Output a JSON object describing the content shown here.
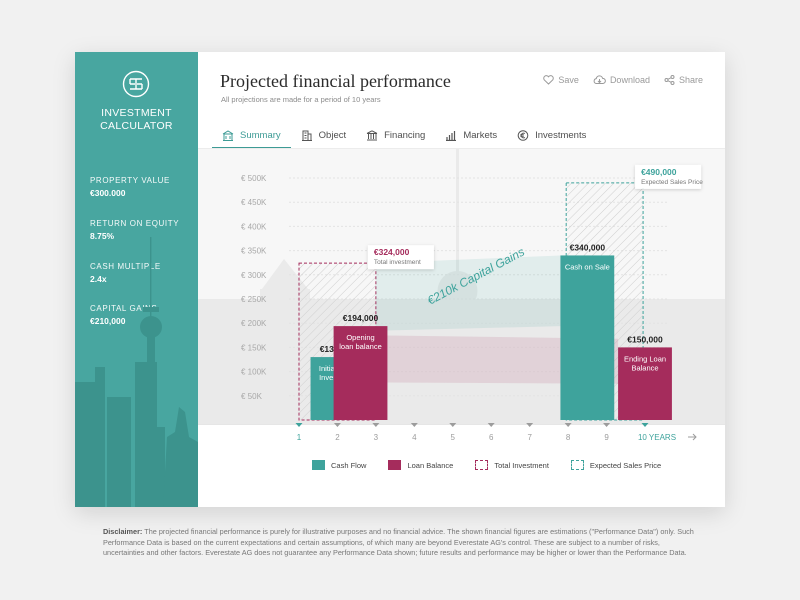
{
  "sidebar": {
    "brand_line1": "INVESTMENT",
    "brand_line2": "CALCULATOR",
    "stats": [
      {
        "label": "PROPERTY VALUE",
        "value": "€300.000"
      },
      {
        "label": "RETURN ON EQUITY",
        "value": "8.75%"
      },
      {
        "label": "CASH MULTIPLE",
        "value": "2.4x"
      },
      {
        "label": "CAPITAL GAINS",
        "value": "€210,000"
      }
    ]
  },
  "header": {
    "title": "Projected financial performance",
    "subtitle": "All projections are made for a period of 10 years",
    "actions": {
      "save": "Save",
      "download": "Download",
      "share": "Share"
    }
  },
  "tabs": [
    {
      "label": "Summary",
      "icon": "building-icon",
      "active": true
    },
    {
      "label": "Object",
      "icon": "house-icon",
      "active": false
    },
    {
      "label": "Financing",
      "icon": "bank-icon",
      "active": false
    },
    {
      "label": "Markets",
      "icon": "bar-chart-icon",
      "active": false
    },
    {
      "label": "Investments",
      "icon": "euro-coin-icon",
      "active": false
    }
  ],
  "colors": {
    "teal": "#3ea39c",
    "magenta": "#a52c5c",
    "sidebar": "#48a6a0",
    "accent": "#3d9b95"
  },
  "chart_data": {
    "type": "bar",
    "y_tick_labels": [
      "€ 50K",
      "€ 100K",
      "€ 150K",
      "€ 200K",
      "€ 250K",
      "€ 300K",
      "€ 350K",
      "€ 400K",
      "€ 450K",
      "€ 500K"
    ],
    "ylim": [
      0,
      500000
    ],
    "x_tick_labels": [
      "1",
      "2",
      "3",
      "4",
      "5",
      "6",
      "7",
      "8",
      "9",
      "10 YEARS"
    ],
    "bars": [
      {
        "series": "Cash Flow",
        "x_start": 1.3,
        "x_end": 2.7,
        "value": 130000,
        "value_label": "€130,000",
        "caption": [
          "Initial Cash",
          "Investment"
        ]
      },
      {
        "series": "Loan Balance",
        "x_start": 1.9,
        "x_end": 3.3,
        "value": 194000,
        "value_label": "€194,000",
        "caption": [
          "Opening",
          "loan balance"
        ]
      },
      {
        "series": "Cash Flow",
        "x_start": 7.8,
        "x_end": 9.2,
        "value": 340000,
        "value_label": "€340,000",
        "caption": [
          "Cash on Sale"
        ]
      },
      {
        "series": "Loan Balance",
        "x_start": 9.3,
        "x_end": 10.7,
        "value": 150000,
        "value_label": "€150,000",
        "caption": [
          "Ending Loan",
          "Balance"
        ]
      }
    ],
    "boxes": [
      {
        "series": "Total Investment",
        "x_start": 1.0,
        "x_end": 3.0,
        "value": 324000,
        "value_label": "€324,000",
        "caption": "Total investment"
      },
      {
        "series": "Expected Sales Price",
        "x_start": 7.95,
        "x_end": 9.95,
        "value": 490000,
        "value_label": "€490,000",
        "caption": "Expected Sales Price"
      }
    ],
    "annotation": "€210k Capital Gains",
    "legend": [
      {
        "name": "Cash Flow",
        "style": "filled",
        "color": "#3ea39c"
      },
      {
        "name": "Loan Balance",
        "style": "filled",
        "color": "#a52c5c"
      },
      {
        "name": "Total Investment",
        "style": "dashed",
        "color": "#a52c5c"
      },
      {
        "name": "Expected Sales Price",
        "style": "dashed",
        "color": "#3ea39c"
      }
    ]
  },
  "disclaimer": {
    "label": "Disclaimer:",
    "text": " The projected financial performance is purely for illustrative purposes and no financial advice. The shown financial figures are estimations (\"Performance Data\") only. Such Performance Data is based on the current expectations and certain assumptions, of which many are beyond Everestate AG's control. These are subject to a number of risks, uncertainties and other factors. Everestate AG does not guarantee any Performance Data shown; future results and performance may be higher or lower than the Performance Data."
  }
}
